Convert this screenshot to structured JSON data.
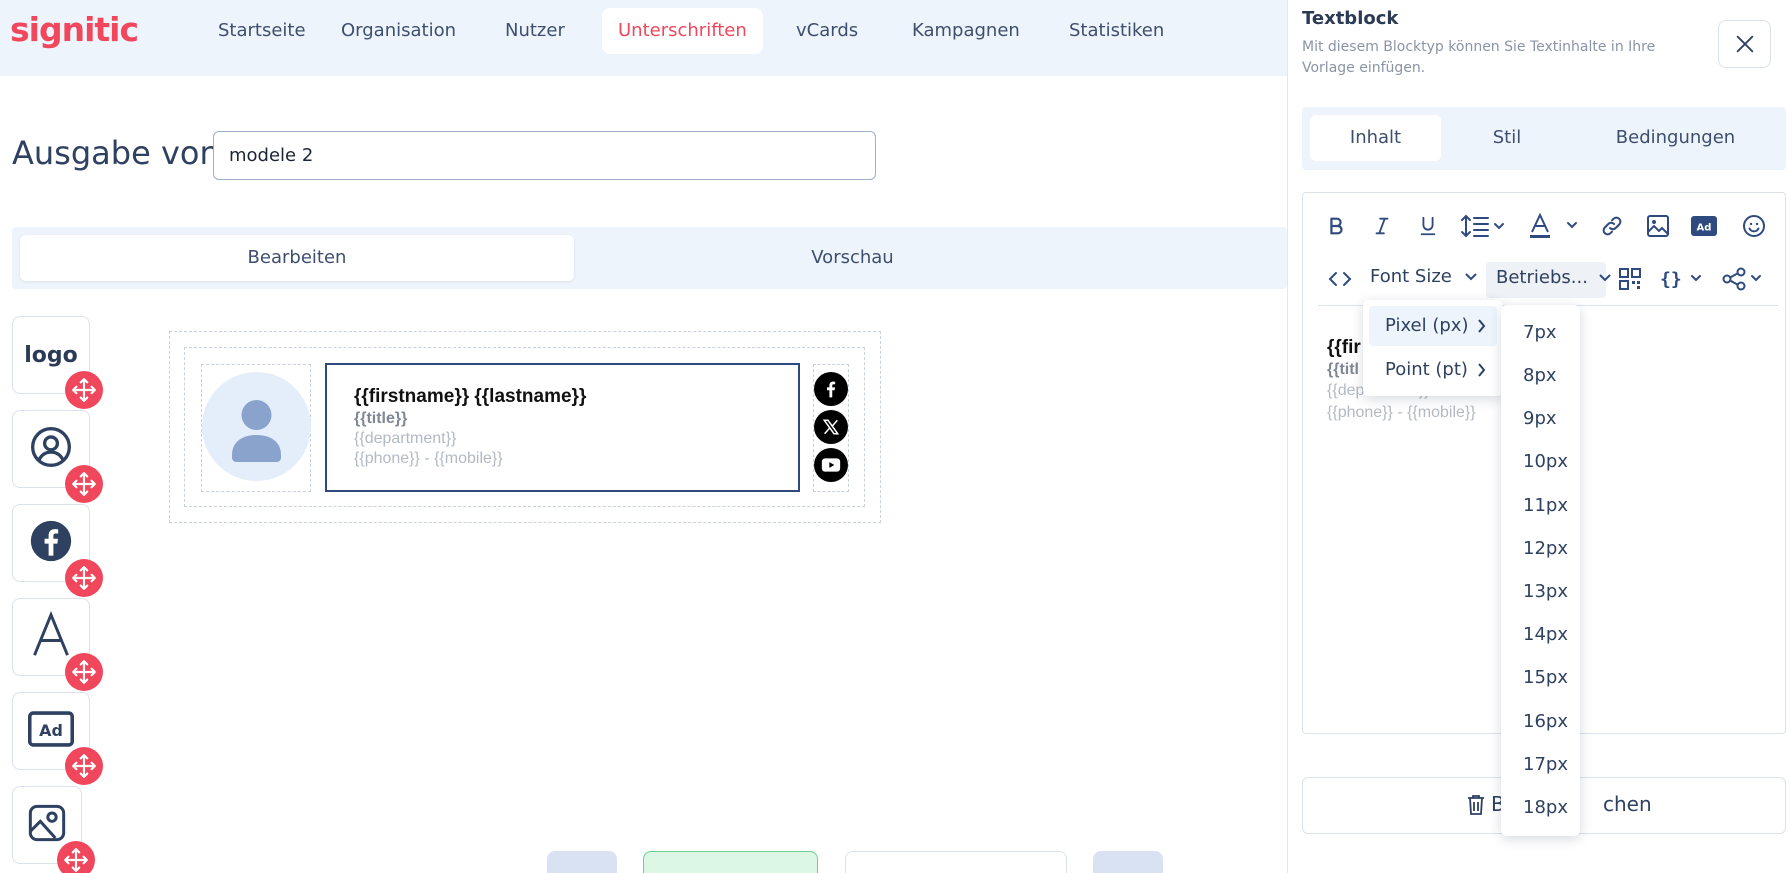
{
  "app": {
    "logo": "signitic"
  },
  "nav": {
    "items": [
      {
        "label": "Startseite"
      },
      {
        "label": "Organisation"
      },
      {
        "label": "Nutzer"
      },
      {
        "label": "Unterschriften",
        "active": true
      },
      {
        "label": "vCards"
      },
      {
        "label": "Kampagnen"
      },
      {
        "label": "Statistiken"
      }
    ]
  },
  "editor_main": {
    "output_label": "Ausgabe von",
    "name_value": "modele 2",
    "tabs": [
      {
        "label": "Bearbeiten",
        "active": true
      },
      {
        "label": "Vorschau"
      }
    ],
    "blocks": [
      {
        "label": "logo",
        "icon": "logo-text-icon"
      },
      {
        "label": "",
        "icon": "user-circle-icon"
      },
      {
        "label": "",
        "icon": "facebook-icon"
      },
      {
        "label": "",
        "icon": "text-a-icon"
      },
      {
        "label": "",
        "icon": "ad-icon"
      },
      {
        "label": "",
        "icon": "image-icon"
      }
    ]
  },
  "signature": {
    "name_line": "{{firstname}} {{lastname}}",
    "title_line": "{{title}}",
    "department_line": "{{department}}",
    "phone_line": "{{phone}} - {{mobile}}",
    "socials": [
      "facebook-icon",
      "x-icon",
      "youtube-icon"
    ]
  },
  "panel": {
    "title": "Textblock",
    "subtitle": "Mit diesem Blocktyp können Sie Textinhalte in Ihre Vorlage einfügen.",
    "tabs": [
      {
        "label": "Inhalt",
        "active": true
      },
      {
        "label": "Stil"
      },
      {
        "label": "Bedingungen"
      }
    ],
    "toolbar": {
      "font_size_label": "Font Size",
      "company_dropdown": "Betriebs..."
    },
    "content": {
      "line1": "{{fir",
      "line2": "{{titl",
      "line3": "{{department}}",
      "line4": "{{phone}} - {{mobile}}"
    },
    "delete_label_left": "B",
    "delete_label_right": "chen"
  },
  "unit_menu": {
    "items": [
      {
        "label": "Pixel (px)",
        "active": true
      },
      {
        "label": "Point (pt)"
      }
    ]
  },
  "size_menu": {
    "items": [
      "7px",
      "8px",
      "9px",
      "10px",
      "11px",
      "12px",
      "13px",
      "14px",
      "15px",
      "16px",
      "17px",
      "18px"
    ]
  },
  "colors": {
    "brand": "#f0475c",
    "navy": "#2e4a7e",
    "nav_bg": "#eef4fc"
  }
}
